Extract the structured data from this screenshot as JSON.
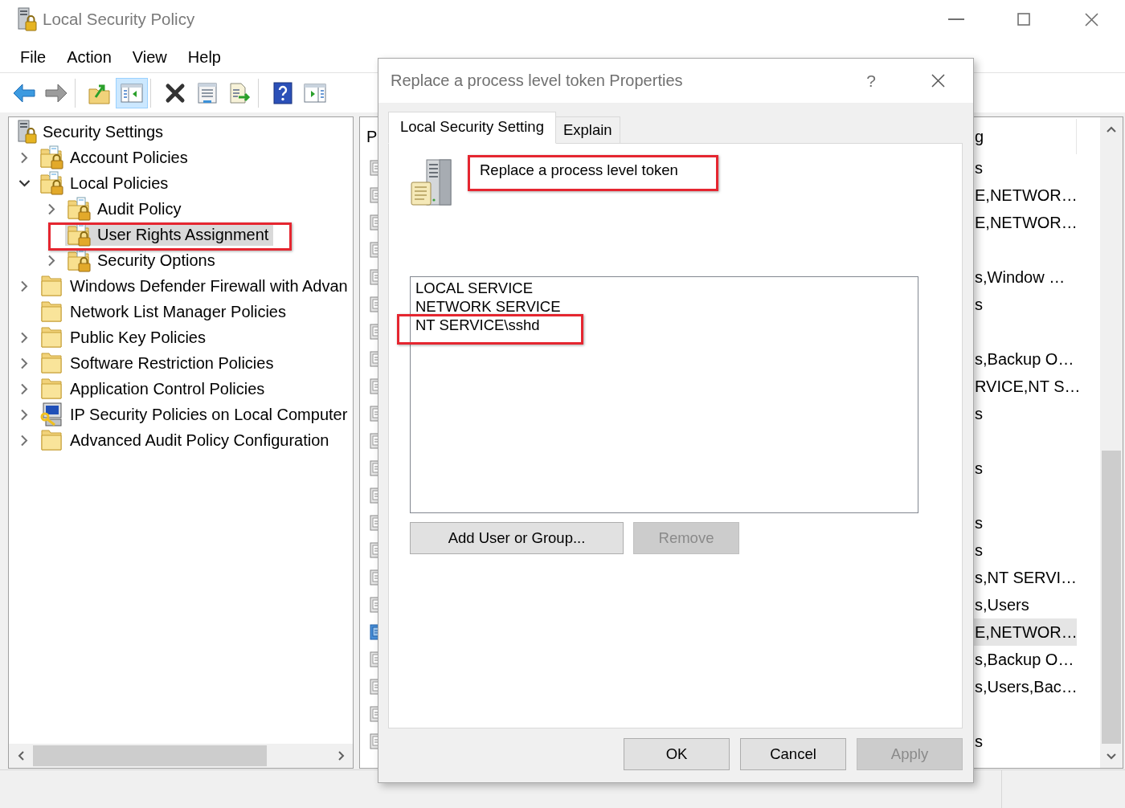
{
  "window": {
    "title": "Local Security Policy"
  },
  "menu": [
    "File",
    "Action",
    "View",
    "Help"
  ],
  "toolbar": {
    "groups": [
      [
        {
          "kind": "back",
          "pressed": false,
          "disabled": false
        },
        {
          "kind": "forward",
          "pressed": false,
          "disabled": true
        }
      ],
      [
        {
          "kind": "up",
          "pressed": false,
          "disabled": false
        },
        {
          "kind": "tree",
          "pressed": true,
          "disabled": false
        }
      ],
      [
        {
          "kind": "delete",
          "pressed": false,
          "disabled": false
        },
        {
          "kind": "properties",
          "pressed": false,
          "disabled": false
        },
        {
          "kind": "export",
          "pressed": false,
          "disabled": false
        }
      ],
      [
        {
          "kind": "help",
          "pressed": false,
          "disabled": false
        },
        {
          "kind": "pane",
          "pressed": false,
          "disabled": false
        }
      ]
    ]
  },
  "tree": {
    "items": [
      {
        "label": "Security Settings",
        "kind": "root",
        "expandable": false,
        "expanded": true,
        "selected": false,
        "highlighted": false,
        "children": [
          {
            "label": "Account Policies",
            "kind": "policy-folder",
            "expandable": true,
            "expanded": false,
            "selected": false,
            "highlighted": false
          },
          {
            "label": "Local Policies",
            "kind": "policy-folder",
            "expandable": true,
            "expanded": true,
            "selected": false,
            "highlighted": false,
            "children": [
              {
                "label": "Audit Policy",
                "kind": "policy-folder",
                "expandable": true,
                "expanded": false,
                "selected": false,
                "highlighted": false
              },
              {
                "label": "User Rights Assignment",
                "kind": "policy-folder",
                "expandable": false,
                "expanded": false,
                "selected": true,
                "highlighted": true
              },
              {
                "label": "Security Options",
                "kind": "policy-folder",
                "expandable": true,
                "expanded": false,
                "selected": false,
                "highlighted": false
              }
            ]
          },
          {
            "label": "Windows Defender Firewall with Advan",
            "kind": "folder",
            "expandable": true,
            "expanded": false,
            "selected": false,
            "highlighted": false
          },
          {
            "label": "Network List Manager Policies",
            "kind": "folder",
            "expandable": false,
            "expanded": false,
            "selected": false,
            "highlighted": false
          },
          {
            "label": "Public Key Policies",
            "kind": "folder",
            "expandable": true,
            "expanded": false,
            "selected": false,
            "highlighted": false
          },
          {
            "label": "Software Restriction Policies",
            "kind": "folder",
            "expandable": true,
            "expanded": false,
            "selected": false,
            "highlighted": false
          },
          {
            "label": "Application Control Policies",
            "kind": "folder",
            "expandable": true,
            "expanded": false,
            "selected": false,
            "highlighted": false
          },
          {
            "label": "IP Security Policies on Local Computer",
            "kind": "ip-security",
            "expandable": true,
            "expanded": false,
            "selected": false,
            "highlighted": false
          },
          {
            "label": "Advanced Audit Policy Configuration",
            "kind": "folder",
            "expandable": true,
            "expanded": false,
            "selected": false,
            "highlighted": false
          }
        ]
      }
    ]
  },
  "details": {
    "columns": [
      "P",
      "g"
    ],
    "rows": [
      {
        "selected": false,
        "column_2": "s"
      },
      {
        "selected": false,
        "column_2": "E,NETWOR…"
      },
      {
        "selected": false,
        "column_2": "E,NETWOR…"
      },
      {
        "selected": false
      },
      {
        "selected": false,
        "column_2": "s,Window …"
      },
      {
        "selected": false,
        "column_2": "s"
      },
      {
        "selected": false
      },
      {
        "selected": false,
        "column_2": "s,Backup O…"
      },
      {
        "selected": false,
        "column_2": "RVICE,NT S…"
      },
      {
        "selected": false,
        "column_2": "s"
      },
      {
        "selected": false
      },
      {
        "selected": false,
        "column_2": "s"
      },
      {
        "selected": false
      },
      {
        "selected": false,
        "column_2": "s"
      },
      {
        "selected": false,
        "column_2": "s"
      },
      {
        "selected": false,
        "column_2": "s,NT SERVI…"
      },
      {
        "selected": false,
        "column_2": "s,Users"
      },
      {
        "selected": true,
        "column_2": "E,NETWOR…"
      },
      {
        "selected": false,
        "column_2": "s,Backup O…"
      },
      {
        "selected": false,
        "column_2": "s,Users,Bac…"
      },
      {
        "selected": false
      },
      {
        "selected": false,
        "column_2": "s"
      }
    ]
  },
  "dialog": {
    "title": "Replace a process level token Properties",
    "help_button": "?",
    "tabs": [
      {
        "label": "Local Security Setting",
        "selected": true
      },
      {
        "label": "Explain",
        "selected": false
      }
    ],
    "policy": {
      "name": "Replace a process level token",
      "highlighted": true
    },
    "accounts": [
      {
        "name": "LOCAL SERVICE",
        "selected": false,
        "highlighted": false
      },
      {
        "name": "NETWORK SERVICE",
        "selected": false,
        "highlighted": false
      },
      {
        "name": "NT SERVICE\\sshd",
        "selected": false,
        "highlighted": true
      }
    ],
    "list_buttons": [
      {
        "label": "Add User or Group...",
        "disabled": false
      },
      {
        "label": "Remove",
        "disabled": true
      }
    ],
    "buttons": [
      {
        "label": "OK",
        "disabled": false
      },
      {
        "label": "Cancel",
        "disabled": false
      },
      {
        "label": "Apply",
        "disabled": true
      }
    ]
  }
}
